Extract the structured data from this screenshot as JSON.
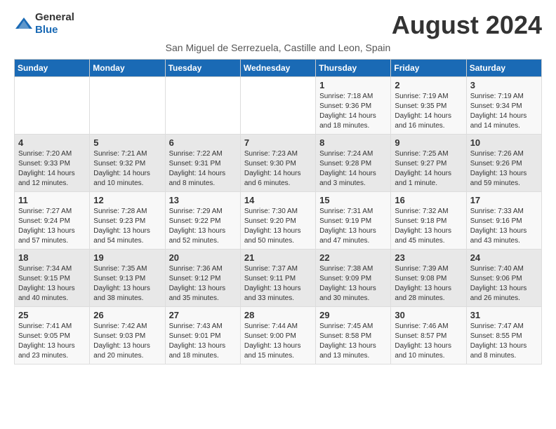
{
  "header": {
    "logo_general": "General",
    "logo_blue": "Blue",
    "title": "August 2024",
    "location": "San Miguel de Serrezuela, Castille and Leon, Spain"
  },
  "weekdays": [
    "Sunday",
    "Monday",
    "Tuesday",
    "Wednesday",
    "Thursday",
    "Friday",
    "Saturday"
  ],
  "weeks": [
    [
      {
        "day": "",
        "info": ""
      },
      {
        "day": "",
        "info": ""
      },
      {
        "day": "",
        "info": ""
      },
      {
        "day": "",
        "info": ""
      },
      {
        "day": "1",
        "info": "Sunrise: 7:18 AM\nSunset: 9:36 PM\nDaylight: 14 hours\nand 18 minutes."
      },
      {
        "day": "2",
        "info": "Sunrise: 7:19 AM\nSunset: 9:35 PM\nDaylight: 14 hours\nand 16 minutes."
      },
      {
        "day": "3",
        "info": "Sunrise: 7:19 AM\nSunset: 9:34 PM\nDaylight: 14 hours\nand 14 minutes."
      }
    ],
    [
      {
        "day": "4",
        "info": "Sunrise: 7:20 AM\nSunset: 9:33 PM\nDaylight: 14 hours\nand 12 minutes."
      },
      {
        "day": "5",
        "info": "Sunrise: 7:21 AM\nSunset: 9:32 PM\nDaylight: 14 hours\nand 10 minutes."
      },
      {
        "day": "6",
        "info": "Sunrise: 7:22 AM\nSunset: 9:31 PM\nDaylight: 14 hours\nand 8 minutes."
      },
      {
        "day": "7",
        "info": "Sunrise: 7:23 AM\nSunset: 9:30 PM\nDaylight: 14 hours\nand 6 minutes."
      },
      {
        "day": "8",
        "info": "Sunrise: 7:24 AM\nSunset: 9:28 PM\nDaylight: 14 hours\nand 3 minutes."
      },
      {
        "day": "9",
        "info": "Sunrise: 7:25 AM\nSunset: 9:27 PM\nDaylight: 14 hours\nand 1 minute."
      },
      {
        "day": "10",
        "info": "Sunrise: 7:26 AM\nSunset: 9:26 PM\nDaylight: 13 hours\nand 59 minutes."
      }
    ],
    [
      {
        "day": "11",
        "info": "Sunrise: 7:27 AM\nSunset: 9:24 PM\nDaylight: 13 hours\nand 57 minutes."
      },
      {
        "day": "12",
        "info": "Sunrise: 7:28 AM\nSunset: 9:23 PM\nDaylight: 13 hours\nand 54 minutes."
      },
      {
        "day": "13",
        "info": "Sunrise: 7:29 AM\nSunset: 9:22 PM\nDaylight: 13 hours\nand 52 minutes."
      },
      {
        "day": "14",
        "info": "Sunrise: 7:30 AM\nSunset: 9:20 PM\nDaylight: 13 hours\nand 50 minutes."
      },
      {
        "day": "15",
        "info": "Sunrise: 7:31 AM\nSunset: 9:19 PM\nDaylight: 13 hours\nand 47 minutes."
      },
      {
        "day": "16",
        "info": "Sunrise: 7:32 AM\nSunset: 9:18 PM\nDaylight: 13 hours\nand 45 minutes."
      },
      {
        "day": "17",
        "info": "Sunrise: 7:33 AM\nSunset: 9:16 PM\nDaylight: 13 hours\nand 43 minutes."
      }
    ],
    [
      {
        "day": "18",
        "info": "Sunrise: 7:34 AM\nSunset: 9:15 PM\nDaylight: 13 hours\nand 40 minutes."
      },
      {
        "day": "19",
        "info": "Sunrise: 7:35 AM\nSunset: 9:13 PM\nDaylight: 13 hours\nand 38 minutes."
      },
      {
        "day": "20",
        "info": "Sunrise: 7:36 AM\nSunset: 9:12 PM\nDaylight: 13 hours\nand 35 minutes."
      },
      {
        "day": "21",
        "info": "Sunrise: 7:37 AM\nSunset: 9:11 PM\nDaylight: 13 hours\nand 33 minutes."
      },
      {
        "day": "22",
        "info": "Sunrise: 7:38 AM\nSunset: 9:09 PM\nDaylight: 13 hours\nand 30 minutes."
      },
      {
        "day": "23",
        "info": "Sunrise: 7:39 AM\nSunset: 9:08 PM\nDaylight: 13 hours\nand 28 minutes."
      },
      {
        "day": "24",
        "info": "Sunrise: 7:40 AM\nSunset: 9:06 PM\nDaylight: 13 hours\nand 26 minutes."
      }
    ],
    [
      {
        "day": "25",
        "info": "Sunrise: 7:41 AM\nSunset: 9:05 PM\nDaylight: 13 hours\nand 23 minutes."
      },
      {
        "day": "26",
        "info": "Sunrise: 7:42 AM\nSunset: 9:03 PM\nDaylight: 13 hours\nand 20 minutes."
      },
      {
        "day": "27",
        "info": "Sunrise: 7:43 AM\nSunset: 9:01 PM\nDaylight: 13 hours\nand 18 minutes."
      },
      {
        "day": "28",
        "info": "Sunrise: 7:44 AM\nSunset: 9:00 PM\nDaylight: 13 hours\nand 15 minutes."
      },
      {
        "day": "29",
        "info": "Sunrise: 7:45 AM\nSunset: 8:58 PM\nDaylight: 13 hours\nand 13 minutes."
      },
      {
        "day": "30",
        "info": "Sunrise: 7:46 AM\nSunset: 8:57 PM\nDaylight: 13 hours\nand 10 minutes."
      },
      {
        "day": "31",
        "info": "Sunrise: 7:47 AM\nSunset: 8:55 PM\nDaylight: 13 hours\nand 8 minutes."
      }
    ]
  ]
}
